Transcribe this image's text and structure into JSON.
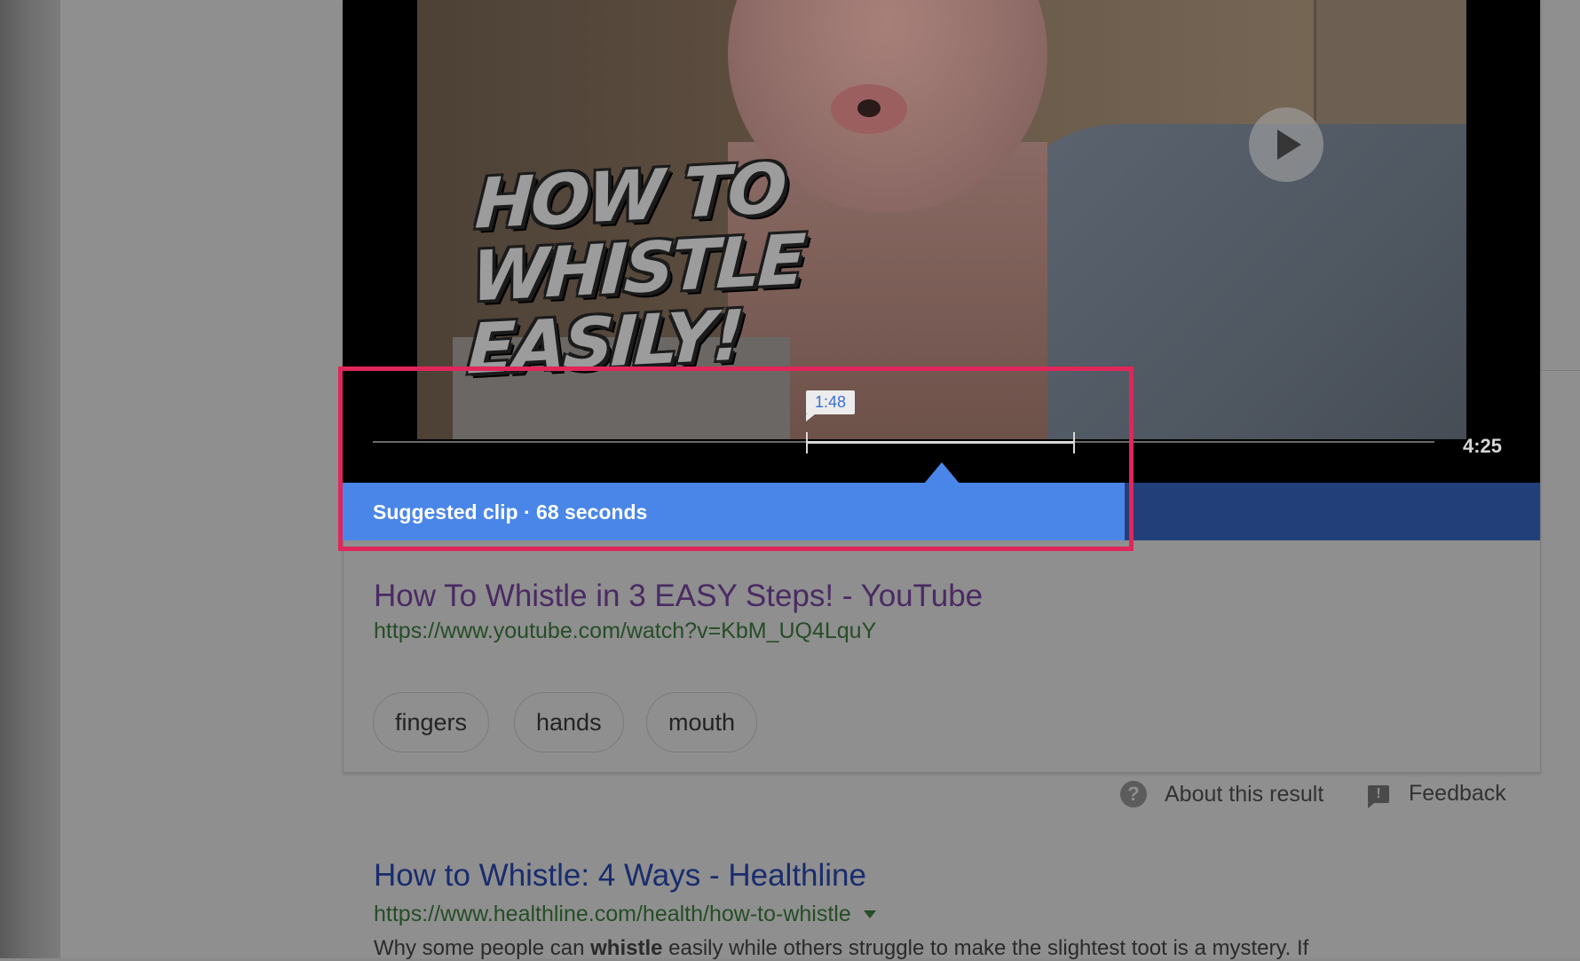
{
  "video": {
    "thumbnail_text_line1": "HOW TO",
    "thumbnail_text_line2": "WHISTLE",
    "thumbnail_text_line3": "EASILY!",
    "play_icon": "play-icon",
    "clip_start_time": "1:48",
    "duration": "4:25",
    "suggested_clip_label": "Suggested clip · 68 seconds"
  },
  "result": {
    "title": "How To Whistle in 3 EASY Steps! - YouTube",
    "url": "https://www.youtube.com/watch?v=KbM_UQ4LquY",
    "chips": [
      "fingers",
      "hands",
      "mouth"
    ]
  },
  "footer": {
    "about": "About this result",
    "about_icon": "help-icon",
    "feedback": "Feedback",
    "feedback_icon": "feedback-icon"
  },
  "result2": {
    "title": "How to Whistle: 4 Ways - Healthline",
    "url": "https://www.healthline.com/health/how-to-whistle",
    "snippet_pre": "Why some people can ",
    "snippet_bold": "whistle",
    "snippet_post": " easily while others struggle to make the slightest toot is a mystery. If"
  },
  "colors": {
    "highlight": "#e0265a",
    "clip_bar": "#4a86e8",
    "visited_link": "#4b2a64",
    "link": "#182c6e",
    "url_green": "#254d26"
  }
}
